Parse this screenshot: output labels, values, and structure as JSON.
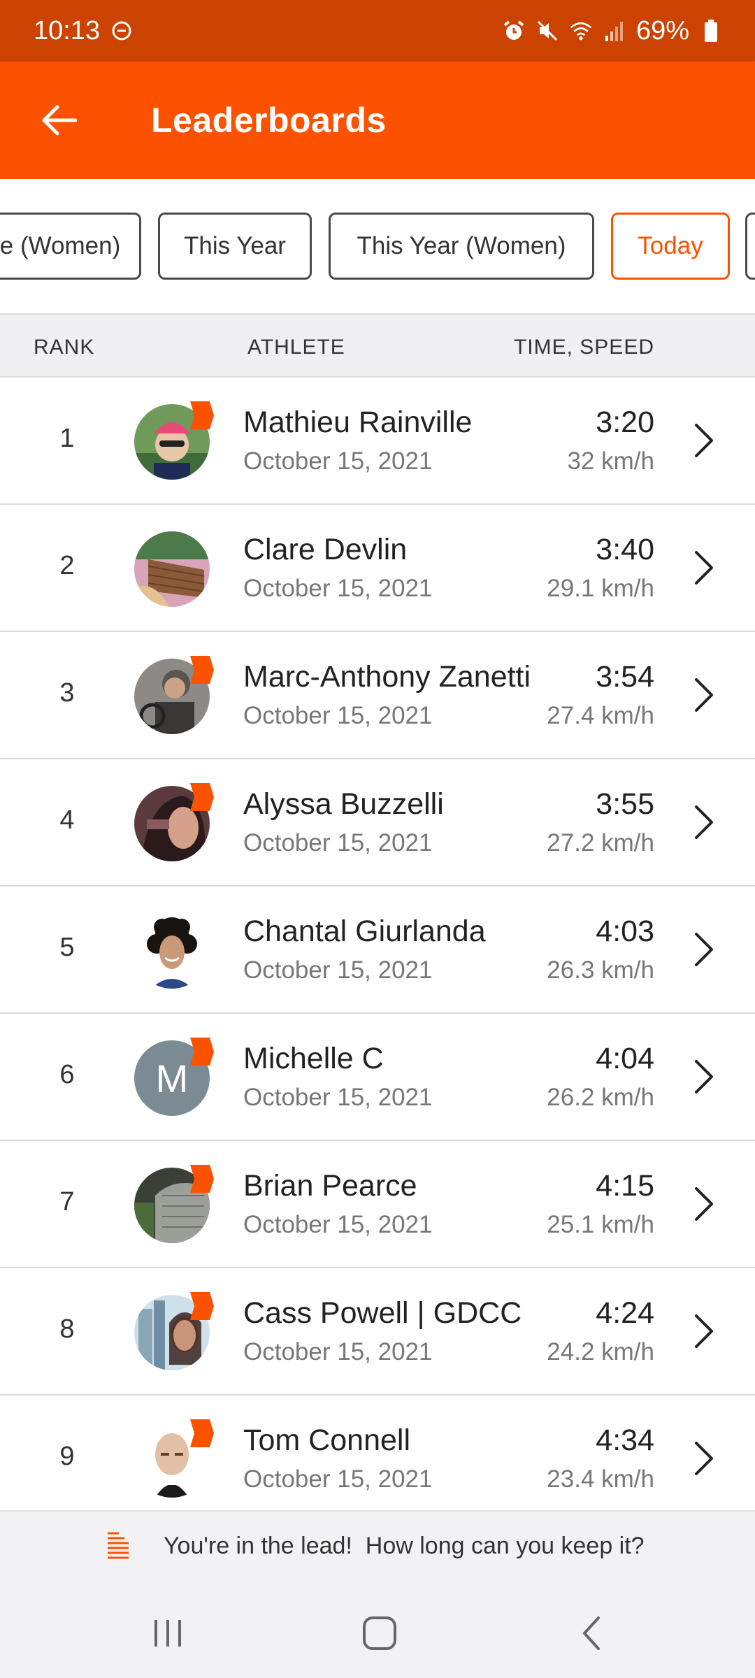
{
  "status": {
    "time": "10:13",
    "battery": "69%"
  },
  "header": {
    "title": "Leaderboards"
  },
  "filters": [
    {
      "label": "e (Women)",
      "active": false
    },
    {
      "label": "This Year",
      "active": false
    },
    {
      "label": "This Year (Women)",
      "active": false
    },
    {
      "label": "Today",
      "active": true
    }
  ],
  "columns": {
    "rank": "RANK",
    "athlete": "ATHLETE",
    "time_speed": "TIME, SPEED"
  },
  "entries": [
    {
      "rank": "1",
      "name": "Mathieu Rainville",
      "date": "October 15, 2021",
      "time": "3:20",
      "speed": "32 km/h",
      "avatar": "photo-cyclist-helmet",
      "badge": true
    },
    {
      "rank": "2",
      "name": "Clare Devlin",
      "date": "October 15, 2021",
      "time": "3:40",
      "speed": "29.1 km/h",
      "avatar": "photo-outdoor-bench",
      "badge": false
    },
    {
      "rank": "3",
      "name": "Marc-Anthony Zanetti",
      "date": "October 15, 2021",
      "time": "3:54",
      "speed": "27.4 km/h",
      "avatar": "photo-rider-bike",
      "badge": true
    },
    {
      "rank": "4",
      "name": "Alyssa Buzzelli",
      "date": "October 15, 2021",
      "time": "3:55",
      "speed": "27.2 km/h",
      "avatar": "photo-woman-dark",
      "badge": true
    },
    {
      "rank": "5",
      "name": "Chantal Giurlanda",
      "date": "October 15, 2021",
      "time": "4:03",
      "speed": "26.3 km/h",
      "avatar": "photo-woman-curly-hair",
      "badge": false
    },
    {
      "rank": "6",
      "name": "Michelle C",
      "date": "October 15, 2021",
      "time": "4:04",
      "speed": "26.2 km/h",
      "avatar": "letter",
      "avatar_letter": "M",
      "badge": true
    },
    {
      "rank": "7",
      "name": "Brian Pearce",
      "date": "October 15, 2021",
      "time": "4:15",
      "speed": "25.1 km/h",
      "avatar": "photo-building",
      "badge": true
    },
    {
      "rank": "8",
      "name": "Cass Powell | GDCC",
      "date": "October 15, 2021",
      "time": "4:24",
      "speed": "24.2 km/h",
      "avatar": "photo-city-selfie",
      "badge": true
    },
    {
      "rank": "9",
      "name": "Tom Connell",
      "date": "October 15, 2021",
      "time": "4:34",
      "speed": "23.4 km/h",
      "avatar": "photo-bald-man",
      "badge": true
    }
  ],
  "banner": {
    "text": "You're in the lead!  How long can you keep it?",
    "icon": "list-lines-icon"
  },
  "colors": {
    "brand": "#fc5200",
    "status_bar": "#cc4200"
  }
}
